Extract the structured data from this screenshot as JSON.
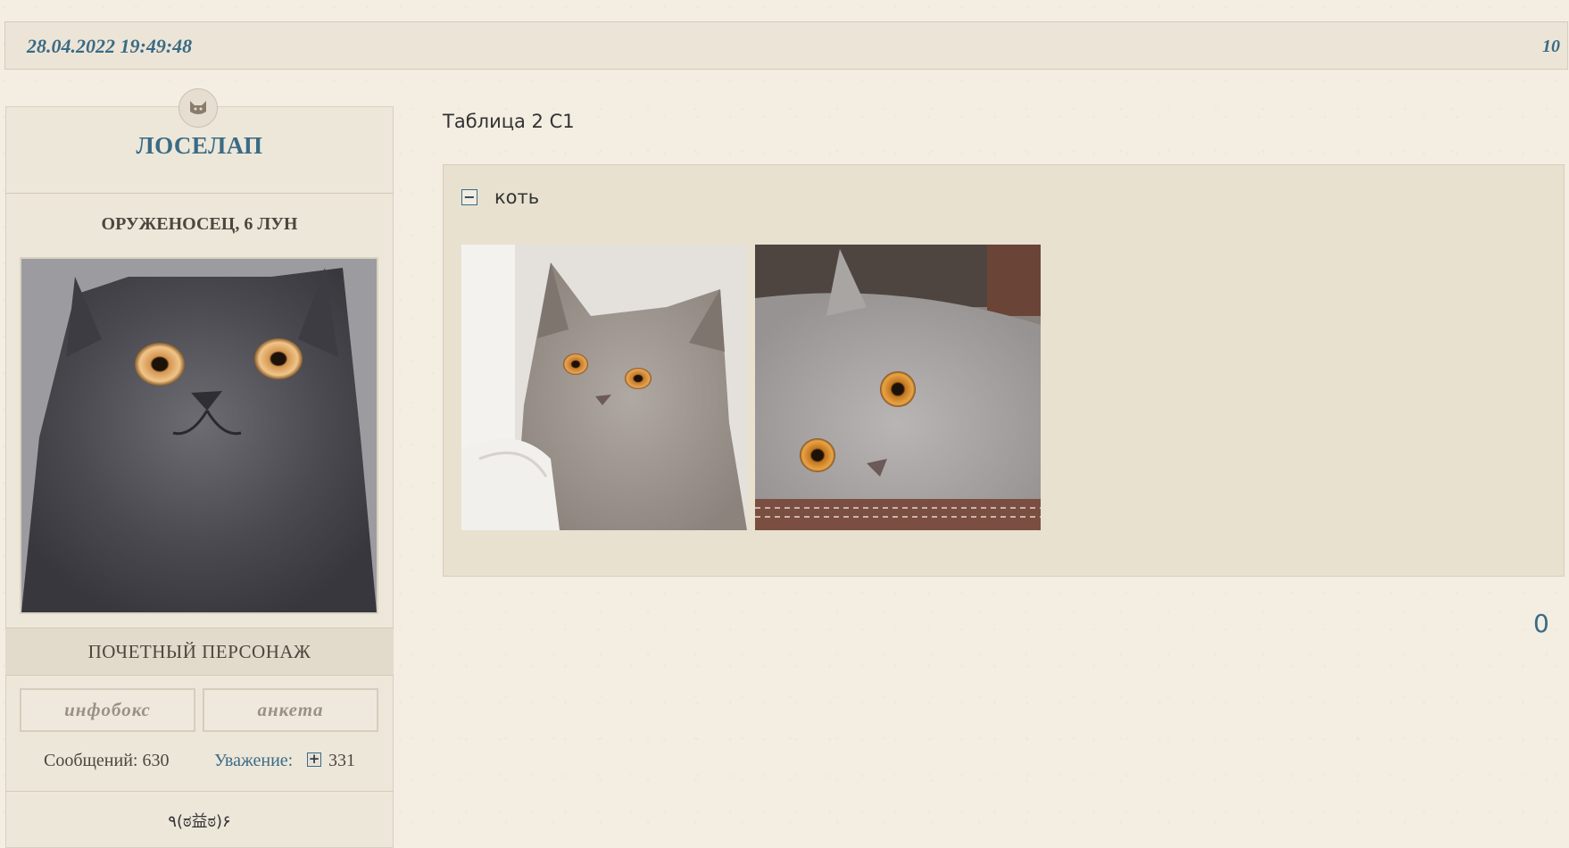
{
  "post": {
    "date": "28.04.2022 19:49:48",
    "number": "10"
  },
  "profile": {
    "emblem_icon": "cat-face-icon",
    "name": "ЛОСЕЛАП",
    "rank": "ОРУЖЕНОСЕЦ, 6 ЛУН",
    "band": "ПОЧЕТНЫЙ ПЕРСОНАЖ",
    "buttons": [
      "инфобокс",
      "анкета"
    ],
    "messages_label": "Сообщений: 630",
    "respect_label": "Уважение:",
    "respect_value": "331",
    "signature": "٩(ಠ益ಠ)۶"
  },
  "content": {
    "title": "Таблица 2 С1",
    "spoiler": {
      "toggle_icon": "minus-box-icon",
      "label": "коть"
    },
    "counter": "0"
  },
  "colors": {
    "accent": "#3a6b85",
    "background": "#f3ede2",
    "panel": "#e8e1d0"
  }
}
